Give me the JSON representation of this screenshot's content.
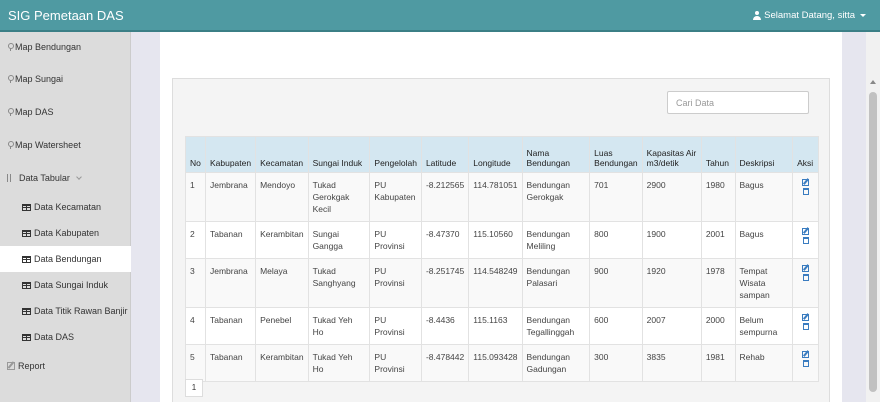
{
  "app": {
    "title": "SIG Pemetaan DAS"
  },
  "user": {
    "greeting": "Selamat Datang, sitta"
  },
  "sidebar": {
    "items": [
      {
        "label": "Map Bendungan"
      },
      {
        "label": "Map Sungai"
      },
      {
        "label": "Map DAS"
      },
      {
        "label": "Map Watersheet"
      },
      {
        "label": "Data Tabular"
      },
      {
        "label": "Data Kecamatan"
      },
      {
        "label": "Data Kabupaten"
      },
      {
        "label": "Data Bendungan"
      },
      {
        "label": "Data Sungai Induk"
      },
      {
        "label": "Data Titik Rawan Banjir"
      },
      {
        "label": "Data DAS"
      },
      {
        "label": "Report"
      }
    ]
  },
  "search": {
    "placeholder": "Cari Data"
  },
  "table": {
    "headers": [
      "No",
      "Kabupaten",
      "Kecamatan",
      "Sungai Induk",
      "Pengelolah",
      "Latitude",
      "Longitude",
      "Nama Bendungan",
      "Luas Bendungan",
      "Kapasitas Air m3/detik",
      "Tahun",
      "Deskripsi",
      "Aksi"
    ],
    "rows": [
      [
        "1",
        "Jembrana",
        "Mendoyo",
        "Tukad Gerokgak Kecil",
        "PU Kabupaten",
        "-8.212565",
        "114.781051",
        "Bendungan Gerokgak",
        "701",
        "2900",
        "1980",
        "Bagus"
      ],
      [
        "2",
        "Tabanan",
        "Kerambitan",
        "Sungai Gangga",
        "PU Provinsi",
        "-8.47370",
        "115.10560",
        "Bendungan Meliling",
        "800",
        "1900",
        "2001",
        "Bagus"
      ],
      [
        "3",
        "Jembrana",
        "Melaya",
        "Tukad Sanghyang",
        "PU Provinsi",
        "-8.251745",
        "114.548249",
        "Bendungan Palasari",
        "900",
        "1920",
        "1978",
        "Tempat Wisata sampan"
      ],
      [
        "4",
        "Tabanan",
        "Penebel",
        "Tukad Yeh Ho",
        "PU Provinsi",
        "-8.4436",
        "115.1163",
        "Bendungan Tegallinggah",
        "600",
        "2007",
        "2000",
        "Belum sempurna"
      ],
      [
        "5",
        "Tabanan",
        "Kerambitan",
        "Tukad Yeh Ho",
        "PU Provinsi",
        "-8.478442",
        "115.093428",
        "Bendungan Gadungan",
        "300",
        "3835",
        "1981",
        "Rehab"
      ]
    ]
  },
  "pagination": {
    "current": "1"
  }
}
